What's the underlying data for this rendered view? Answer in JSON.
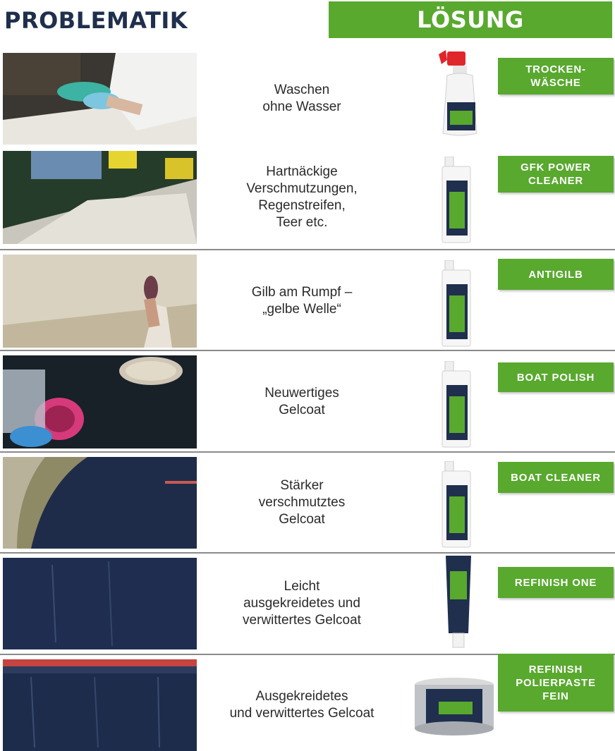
{
  "header": {
    "problem_title": "PROBLEMATIK",
    "solution_title": "LÖSUNG"
  },
  "colors": {
    "brand_green": "#58a92e",
    "title_navy": "#1f2f4d",
    "divider": "#8a8a8a"
  },
  "rows": [
    {
      "problem": "Waschen\nohne Wasser",
      "solution": "TROCKEN-\nWÄSCHE",
      "product_icon": "spray-bottle-icon"
    },
    {
      "problem": "Hartnäckige\nVerschmutzungen,\nRegenstreifen,\nTeer etc.",
      "solution": "GFK POWER\nCLEANER",
      "product_icon": "bottle-icon"
    },
    {
      "problem": "Gilb am Rumpf –\n„gelbe Welle“",
      "solution": "ANTIGILB",
      "product_icon": "bottle-icon"
    },
    {
      "problem": "Neuwertiges\nGelcoat",
      "solution": "BOAT POLISH",
      "product_icon": "bottle-icon"
    },
    {
      "problem": "Stärker\nverschmutztes\nGelcoat",
      "solution": "BOAT CLEANER",
      "product_icon": "bottle-icon"
    },
    {
      "problem": "Leicht\nausgekreidetes und\nverwittertes Gelcoat",
      "solution": "REFINISH ONE",
      "product_icon": "tube-icon"
    },
    {
      "problem": "Ausgekreidetes\nund verwittertes Gelcoat",
      "solution": "REFINISH\nPOLIERPASTE\nFEIN",
      "product_icon": "tin-can-icon"
    }
  ]
}
